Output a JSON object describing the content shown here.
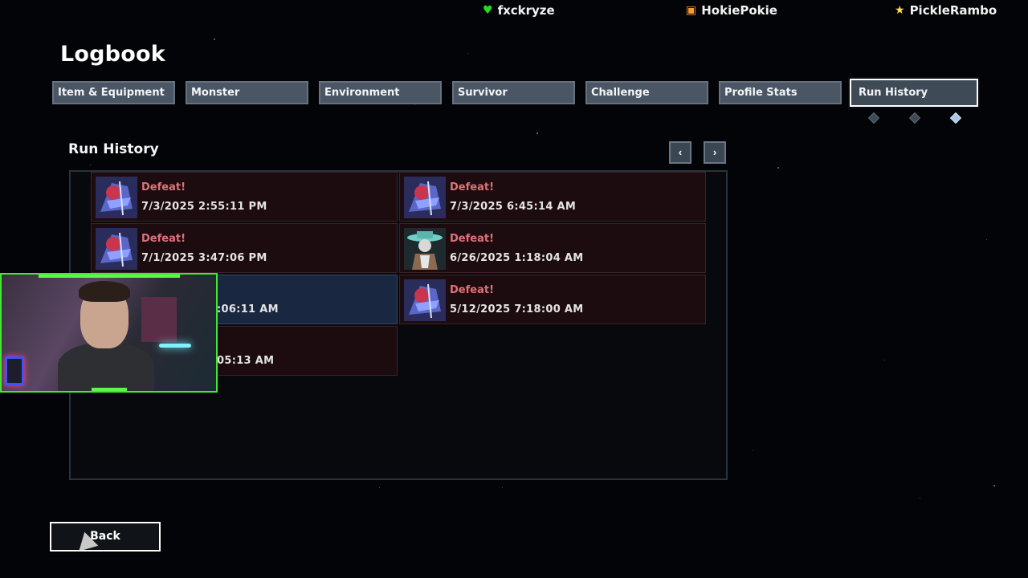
{
  "users": [
    {
      "name": "fxckryze",
      "icon": "heart-icon",
      "color": "#22dd22"
    },
    {
      "name": "HokiePokie",
      "icon": "gift-icon",
      "color": "#ff9a2e"
    },
    {
      "name": "PickleRambo",
      "icon": "star-icon",
      "color": "#ffe14a"
    }
  ],
  "page_title": "Logbook",
  "tabs": [
    {
      "label": "Item & Equipment",
      "active": false
    },
    {
      "label": "Monster",
      "active": false
    },
    {
      "label": "Environment",
      "active": false
    },
    {
      "label": "Survivor",
      "active": false
    },
    {
      "label": "Challenge",
      "active": false
    },
    {
      "label": "Profile Stats",
      "active": false
    },
    {
      "label": "Run History",
      "active": true
    }
  ],
  "tab_pages": {
    "count": 3,
    "current": 3
  },
  "section": {
    "title": "Run History",
    "prev_label": "‹",
    "next_label": "›"
  },
  "runs": [
    {
      "result": "Defeat!",
      "date": "7/3/2025 2:55:11 PM",
      "survivor_icon": "huntress-portrait-icon"
    },
    {
      "result": "Defeat!",
      "date": "7/3/2025 6:45:14 AM",
      "survivor_icon": "huntress-portrait-icon"
    },
    {
      "result": "Defeat!",
      "date": "7/1/2025 3:47:06 PM",
      "survivor_icon": "huntress-portrait-icon"
    },
    {
      "result": "Defeat!",
      "date": "6/26/2025 1:18:04 AM",
      "survivor_icon": "bandit-portrait-icon"
    },
    {
      "result": "",
      "date": ":06:11 AM",
      "survivor_icon": "",
      "selected": true
    },
    {
      "result": "Defeat!",
      "date": "5/12/2025 7:18:00 AM",
      "survivor_icon": "huntress-portrait-icon"
    },
    {
      "result": "",
      "date": "05:13 AM",
      "survivor_icon": ""
    }
  ],
  "back_label": "Back",
  "colors": {
    "defeat_text": "#e0727a",
    "run_card": "#1c0c0f",
    "selected_card": "#1a2740",
    "tab_bg": "#4a5663",
    "webcam_border": "#43e832"
  }
}
